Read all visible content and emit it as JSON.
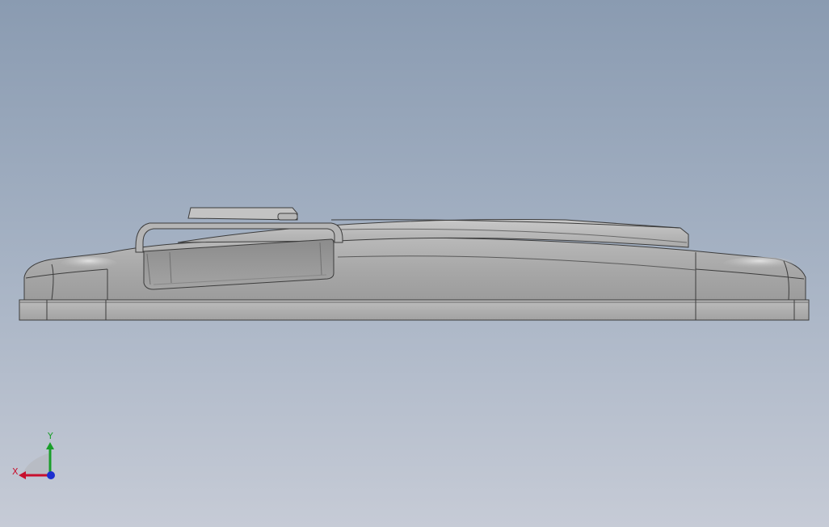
{
  "viewport": {
    "background_top": "#8a9bb1",
    "background_bottom": "#c6cbd6"
  },
  "model": {
    "icon": "cad-part-side-view",
    "body_color": "#a7a7a7",
    "edge_color": "#3c3c3c"
  },
  "triad": {
    "x_label": "X",
    "y_label": "Y",
    "x_color": "#c8102e",
    "y_color": "#1a9e2a",
    "z_color": "#1c2fd0"
  }
}
